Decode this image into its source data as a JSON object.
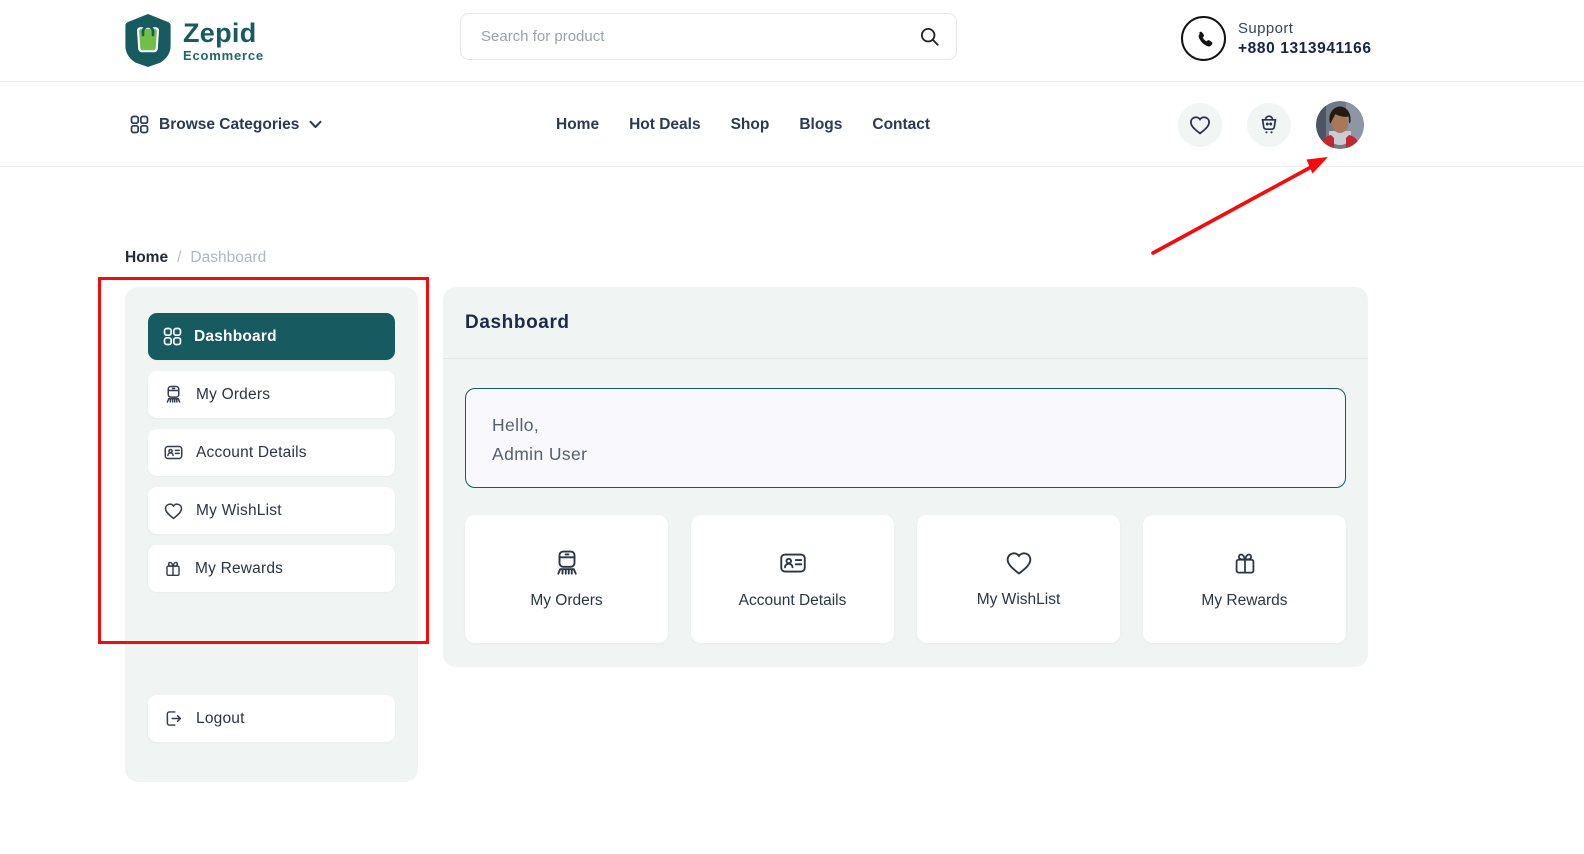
{
  "brand": {
    "name": "Zepid",
    "tagline": "Ecommerce"
  },
  "header": {
    "search_placeholder": "Search for product",
    "support_label": "Support",
    "support_phone": "+880 1313941166"
  },
  "navbar": {
    "browse_label": "Browse Categories",
    "links": [
      "Home",
      "Hot Deals",
      "Shop",
      "Blogs",
      "Contact"
    ]
  },
  "breadcrumb": {
    "home": "Home",
    "separator": "/",
    "current": "Dashboard"
  },
  "sidebar": {
    "items": [
      {
        "label": "Dashboard",
        "icon": "grid-icon",
        "active": true
      },
      {
        "label": "My Orders",
        "icon": "orders-icon",
        "active": false
      },
      {
        "label": "Account Details",
        "icon": "id-card-icon",
        "active": false
      },
      {
        "label": "My WishList",
        "icon": "heart-icon",
        "active": false
      },
      {
        "label": "My Rewards",
        "icon": "gift-icon",
        "active": false
      }
    ],
    "logout_label": "Logout"
  },
  "main": {
    "title": "Dashboard",
    "greeting": {
      "line1": "Hello,",
      "line2": "Admin User"
    },
    "cards": [
      {
        "label": "My Orders",
        "icon": "orders-icon"
      },
      {
        "label": "Account Details",
        "icon": "id-card-icon"
      },
      {
        "label": "My WishList",
        "icon": "heart-icon"
      },
      {
        "label": "My Rewards",
        "icon": "gift-icon"
      }
    ]
  },
  "colors": {
    "accent_teal": "#175a60",
    "logo_green": "#6fbf4a",
    "panel_background": "#f0f4f3",
    "text_dark": "#2b3445",
    "annotation_red": "#f40b0b"
  }
}
